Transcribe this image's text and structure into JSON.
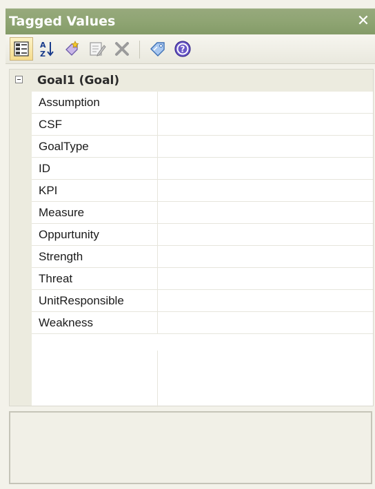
{
  "window": {
    "title": "Tagged Values",
    "close_glyph": "✕"
  },
  "toolbar": {
    "buttons": [
      {
        "name": "categorized-view-button",
        "icon": "categorized-icon",
        "active": true
      },
      {
        "name": "alphabetical-sort-button",
        "icon": "sort-az-icon",
        "active": false
      },
      {
        "name": "new-tag-button",
        "icon": "new-tag-icon",
        "active": false
      },
      {
        "name": "edit-notes-button",
        "icon": "edit-notes-icon",
        "active": false
      },
      {
        "name": "delete-tag-button",
        "icon": "delete-icon",
        "active": false
      },
      {
        "name": "tag-button",
        "icon": "tag-icon",
        "active": false
      },
      {
        "name": "help-button",
        "icon": "help-icon",
        "active": false
      }
    ]
  },
  "grid": {
    "category": "Goal1 (Goal)",
    "properties": [
      {
        "name": "Assumption",
        "value": ""
      },
      {
        "name": "CSF",
        "value": ""
      },
      {
        "name": "GoalType",
        "value": ""
      },
      {
        "name": "ID",
        "value": ""
      },
      {
        "name": "KPI",
        "value": ""
      },
      {
        "name": "Measure",
        "value": ""
      },
      {
        "name": "Oppurtunity",
        "value": ""
      },
      {
        "name": "Strength",
        "value": ""
      },
      {
        "name": "Threat",
        "value": ""
      },
      {
        "name": "UnitResponsible",
        "value": ""
      },
      {
        "name": "Weakness",
        "value": ""
      }
    ]
  },
  "description": {
    "text": ""
  },
  "colors": {
    "titlebar": "#8ea472",
    "toolbar": "#efeee6",
    "gutter": "#ecebdf"
  }
}
